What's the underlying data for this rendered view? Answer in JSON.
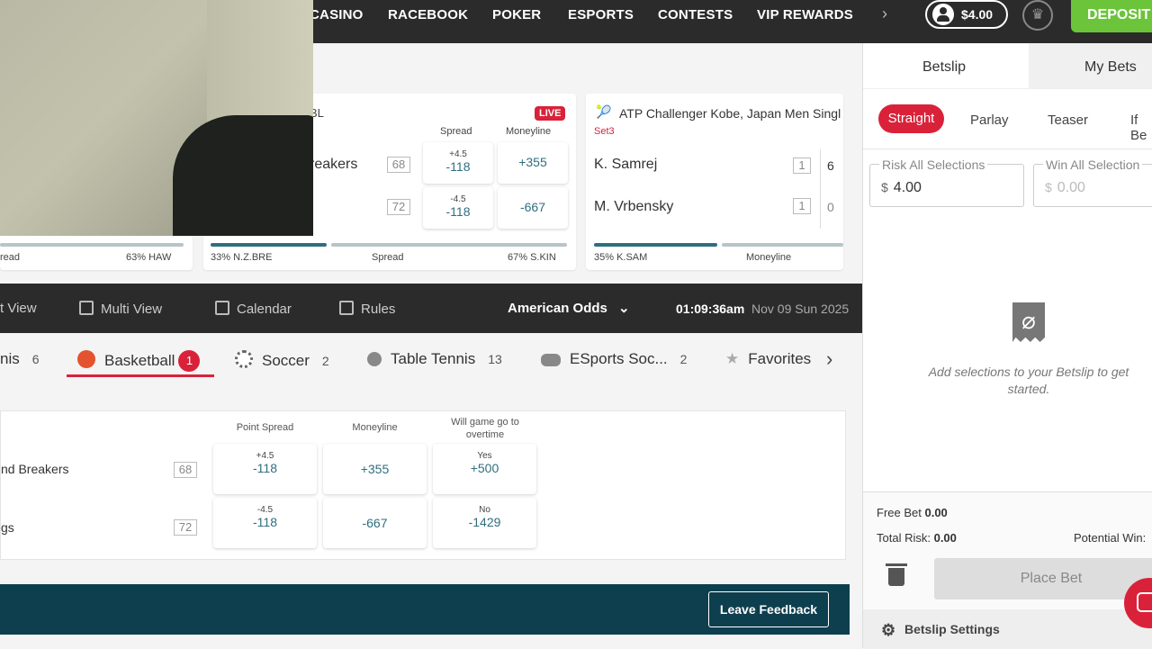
{
  "topnav": {
    "links": [
      "CASINO",
      "RACEBOOK",
      "POKER",
      "ESPORTS",
      "CONTESTS",
      "VIP REWARDS"
    ],
    "balance": "$4.00",
    "deposit": "DEPOSIT"
  },
  "cards": {
    "card1": {
      "foot_left": "read",
      "foot_right": "63% HAW"
    },
    "card2": {
      "league": "BL",
      "live": "LIVE",
      "spread_head": "Spread",
      "moneyline_head": "Moneyline",
      "team1": "reakers",
      "team1_score": "68",
      "team2_score": "72",
      "spread1_top": "+4.5",
      "spread1_main": "-118",
      "spread2_top": "-4.5",
      "spread2_main": "-118",
      "ml1": "+355",
      "ml2": "-667",
      "foot_left": "33% N.Z.BRE",
      "foot_mid": "Spread",
      "foot_right": "67% S.KIN"
    },
    "card3": {
      "title": "ATP Challenger Kobe, Japan Men Singl",
      "set": "Set3",
      "player1": "K. Samrej",
      "p1_sets": "1",
      "p1_games": "6",
      "player2": "M. Vrbensky",
      "p2_sets": "1",
      "p2_games": "0",
      "foot_left": "35% K.SAM",
      "foot_mid": "Moneyline"
    }
  },
  "subnav": {
    "items": [
      "t View",
      "Multi View",
      "Calendar",
      "Rules"
    ],
    "odds_format": "American Odds",
    "time": "01:09:36am",
    "date": "Nov 09 Sun 2025"
  },
  "sports": {
    "items": [
      {
        "label": "nis",
        "count": "6"
      },
      {
        "label": "Basketball",
        "count": "1"
      },
      {
        "label": "Soccer",
        "count": "2"
      },
      {
        "label": "Table Tennis",
        "count": "13"
      },
      {
        "label": "ESports Soc...",
        "count": "2"
      },
      {
        "label": "Favorites"
      }
    ]
  },
  "table": {
    "headers": [
      "Point Spread",
      "Moneyline",
      "Will game go to overtime"
    ],
    "rows": [
      {
        "team": "nd Breakers",
        "score": "68",
        "spread_top": "+4.5",
        "spread_main": "-118",
        "ml": "+355",
        "ot_label": "Yes",
        "ot_odds": "+500"
      },
      {
        "team": "gs",
        "score": "72",
        "spread_top": "-4.5",
        "spread_main": "-118",
        "ml": "-667",
        "ot_label": "No",
        "ot_odds": "-1429"
      }
    ]
  },
  "feedback": {
    "label": "Leave Feedback"
  },
  "betslip": {
    "tabs": [
      "Betslip",
      "My Bets"
    ],
    "types": [
      "Straight",
      "Parlay",
      "Teaser",
      "If Be"
    ],
    "risk_label": "Risk All Selections",
    "risk_value": "4.00",
    "win_label": "Win All Selection",
    "win_value": "0.00",
    "currency": "$",
    "empty_text": "Add selections to your Betslip to get started.",
    "free_bet_label": "Free Bet",
    "free_bet": "0.00",
    "total_risk_label": "Total Risk:",
    "total_risk": "0.00",
    "potential_win": "Potential Win:",
    "place_bet": "Place Bet",
    "settings": "Betslip Settings"
  }
}
